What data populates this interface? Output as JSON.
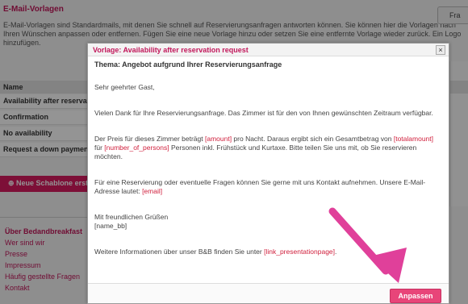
{
  "background": {
    "title": "E-Mail-Vorlagen",
    "intro": "E-Mail-Vorlagen sind Standardmails, mit denen Sie schnell auf Reservierungsanfragen antworten können. Sie können hier die Vorlagen nach Ihren Wünschen anpassen oder entfernen. Fügen Sie eine neue Vorlage hinzu oder setzen Sie eine entfernte Vorlage wieder zurück. Ein Logo hinzufügen.",
    "top_button": "Fra",
    "table_header": "Name",
    "rows": [
      "Availability after reservation request",
      "Confirmation",
      "No availability",
      "Request a down payment"
    ],
    "new_template_button": "Neue Schablone erstellen",
    "footer_title": "Über Bedandbreakfast",
    "footer_links": [
      "Wer sind wir",
      "Presse",
      "Impressum",
      "Häufig gestellte Fragen",
      "Kontakt"
    ]
  },
  "modal": {
    "title": "Vorlage: Availability after reservation request",
    "close": "×",
    "subject": "Thema: Angebot aufgrund Ihrer Reservierungsanfrage",
    "greeting": "Sehr geehrter Gast,",
    "p1": "Vielen Dank für Ihre Reservierungsanfrage. Das Zimmer ist für den von Ihnen gewünschten Zeitraum verfügbar.",
    "p2_a": "Der Preis für dieses Zimmer beträgt ",
    "ph_amount": "[amount]",
    "p2_b": " pro Nacht. Daraus ergibt sich ein Gesamtbetrag von ",
    "ph_totalamount": "[totalamount]",
    "p2_c": " für ",
    "ph_persons": "[number_of_persons]",
    "p2_d": " Personen inkl. Frühstück und Kurtaxe. Bitte teilen Sie uns mit, ob Sie reservieren möchten.",
    "p3": "Für eine Reservierung oder eventuelle Fragen können Sie gerne mit uns Kontakt aufnehmen. Unsere E-Mail-Adresse lautet: ",
    "ph_email": "[email]",
    "closing": "Mit freundlichen Grüßen",
    "ph_name": "[name_bb]",
    "p4_a": "Weitere Informationen über unser B&B finden Sie unter ",
    "ph_link": "[link_presentationpage]",
    "p4_b": ".",
    "apply_button": "Anpassen"
  },
  "colors": {
    "accent": "#c2185b",
    "button": "#e84579",
    "placeholder": "#d01f3c",
    "arrow": "#e0409a"
  }
}
